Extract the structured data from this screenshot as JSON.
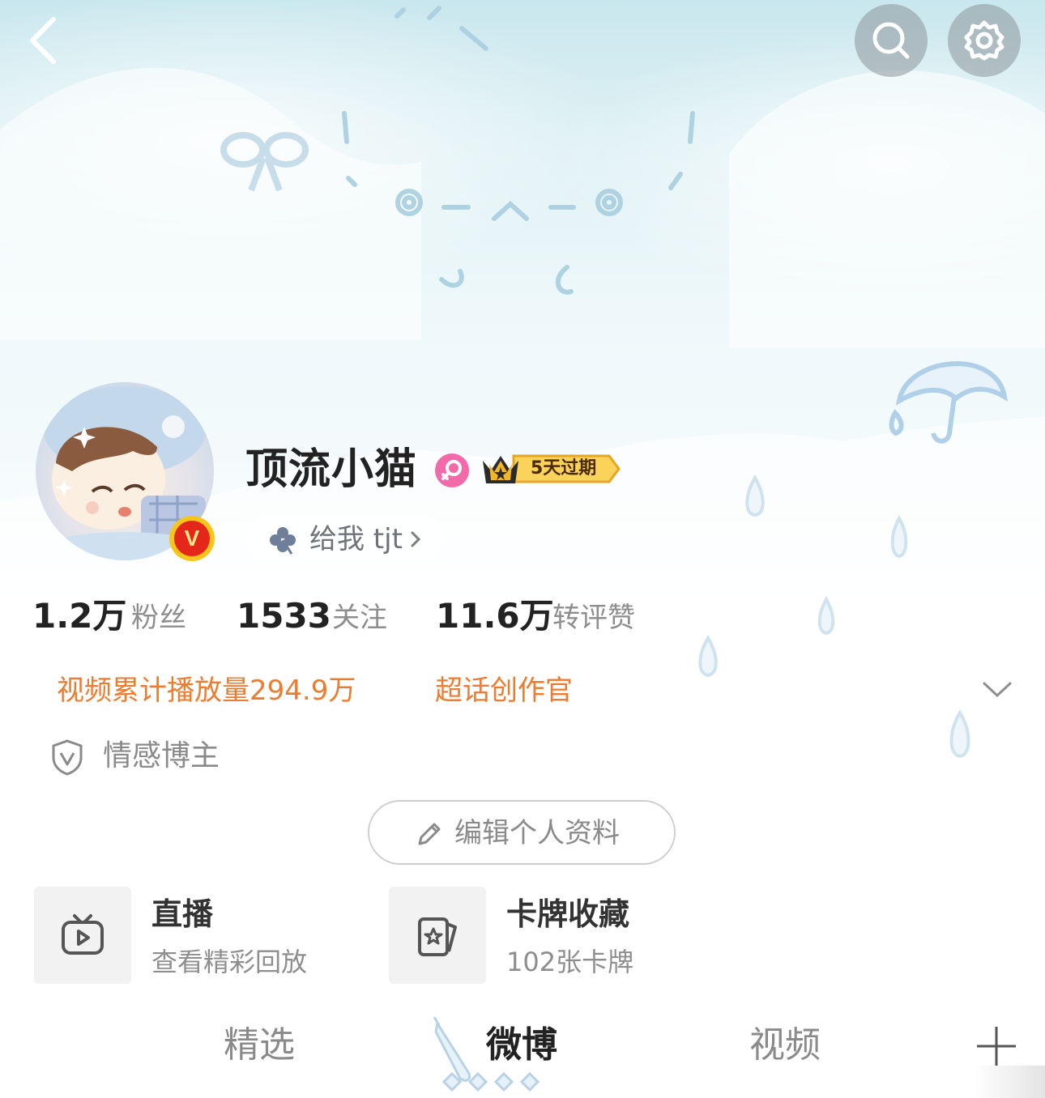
{
  "profile": {
    "username": "顶流小猫",
    "vip_badge_text": "5天过期",
    "signature": "给我 tjt",
    "verified_type": "V"
  },
  "stats": [
    {
      "value": "1.2万",
      "label": "粉丝"
    },
    {
      "value": "1533",
      "label": "关注"
    },
    {
      "value": "11.6万",
      "label": "转评赞"
    }
  ],
  "honors": [
    "视频累计播放量294.9万",
    "超话创作官"
  ],
  "certification": "情感博主",
  "edit_profile_label": "编辑个人资料",
  "entries": [
    {
      "title": "直播",
      "subtitle": "查看精彩回放",
      "icon": "live-tv-icon"
    },
    {
      "title": "卡牌收藏",
      "subtitle": "102张卡牌",
      "icon": "card-collection-icon"
    }
  ],
  "tabs": [
    {
      "label": "精选",
      "active": false
    },
    {
      "label": "微博",
      "active": true
    },
    {
      "label": "视频",
      "active": false
    }
  ],
  "colors": {
    "accent_orange": "#ef7b2f",
    "verified_red": "#e5271b",
    "verified_gold": "#f8c61b",
    "female_pink": "#f26aa9",
    "header_sky": "#c9e7ee"
  }
}
